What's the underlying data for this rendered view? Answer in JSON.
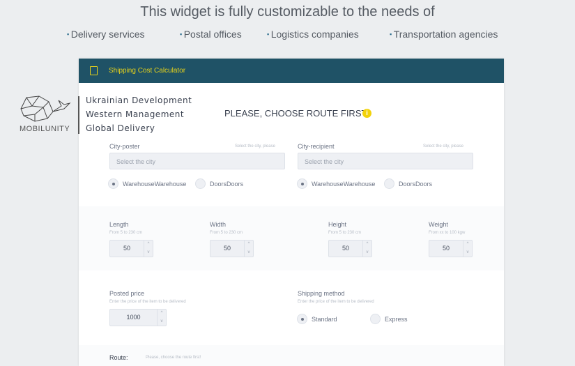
{
  "headline": "This widget is fully customizable to the needs of",
  "audiences": [
    "Delivery services",
    "Postal offices",
    "Logistics companies",
    "Transportation agencies"
  ],
  "logo": {
    "name": "MOBILUNITY"
  },
  "taglines": [
    "Ukrainian Development",
    "Western Management",
    "Global Delivery"
  ],
  "card": {
    "title": "Shipping Cost Calculator",
    "notice": "PLEASE, CHOOSE ROUTE FIRST",
    "poster": {
      "label": "City-poster",
      "hint": "Select the city, please",
      "placeholder": "Select the city"
    },
    "recipient": {
      "label": "City-recipient",
      "hint": "Select the city, please",
      "placeholder": "Select the city"
    },
    "delivery_options": [
      "WarehouseWarehouse",
      "DoorsDoors"
    ],
    "dims": [
      {
        "label": "Length",
        "hint": "From 5 to 230 cm",
        "value": "50"
      },
      {
        "label": "Width",
        "hint": "From 5 to 230 cm",
        "value": "50"
      },
      {
        "label": "Height",
        "hint": "From 5 to 230 cm",
        "value": "50"
      },
      {
        "label": "Weight",
        "hint": "From xx to 100 kgw",
        "value": "50"
      }
    ],
    "price": {
      "label": "Posted price",
      "hint": "Enter the price of the item to be delivered",
      "value": "1000"
    },
    "method": {
      "label": "Shipping method",
      "hint": "Enter the price of the item to be delivered",
      "options": [
        "Standard",
        "Express"
      ]
    },
    "route": {
      "label": "Route:",
      "text": "Please, choose the route first!"
    }
  }
}
